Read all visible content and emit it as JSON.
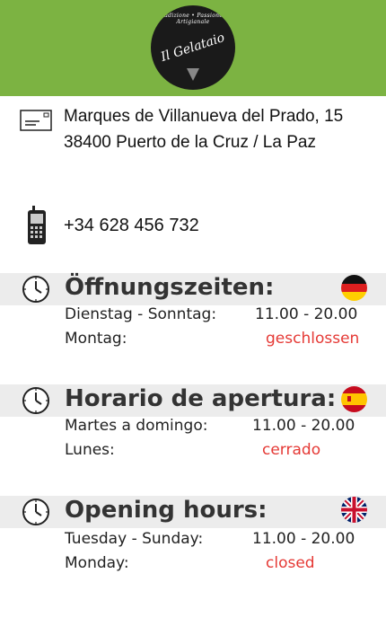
{
  "logo": {
    "top_text": "Tradizione • Passione • Artigianale",
    "name": "Il Gelataio"
  },
  "address": {
    "line1": "Marques de Villanueva del Prado, 15",
    "line2": "38400 Puerto de la Cruz / La Paz"
  },
  "phone": "+34 628 456 732",
  "sections": [
    {
      "title": "Öffnungszeiten:",
      "rows": [
        {
          "label": "Dienstag - Sonntag:",
          "value": "11.00 - 20.00"
        },
        {
          "label": "Montag:",
          "value": "geschlossen"
        }
      ]
    },
    {
      "title": "Horario de apertura:",
      "rows": [
        {
          "label": "Martes a domingo:",
          "value": "11.00 - 20.00"
        },
        {
          "label": "Lunes:",
          "value": "cerrado"
        }
      ]
    },
    {
      "title": "Opening hours:",
      "rows": [
        {
          "label": "Tuesday - Sunday:",
          "value": "11.00 - 20.00"
        },
        {
          "label": "Monday:",
          "value": "closed"
        }
      ]
    }
  ],
  "colors": {
    "header": "#7cb342",
    "band": "#ececec",
    "closed": "#e53935"
  },
  "icons": [
    "envelope-icon",
    "mobile-phone-icon",
    "clock-icon",
    "flag-germany-icon",
    "flag-spain-icon",
    "flag-uk-icon"
  ]
}
